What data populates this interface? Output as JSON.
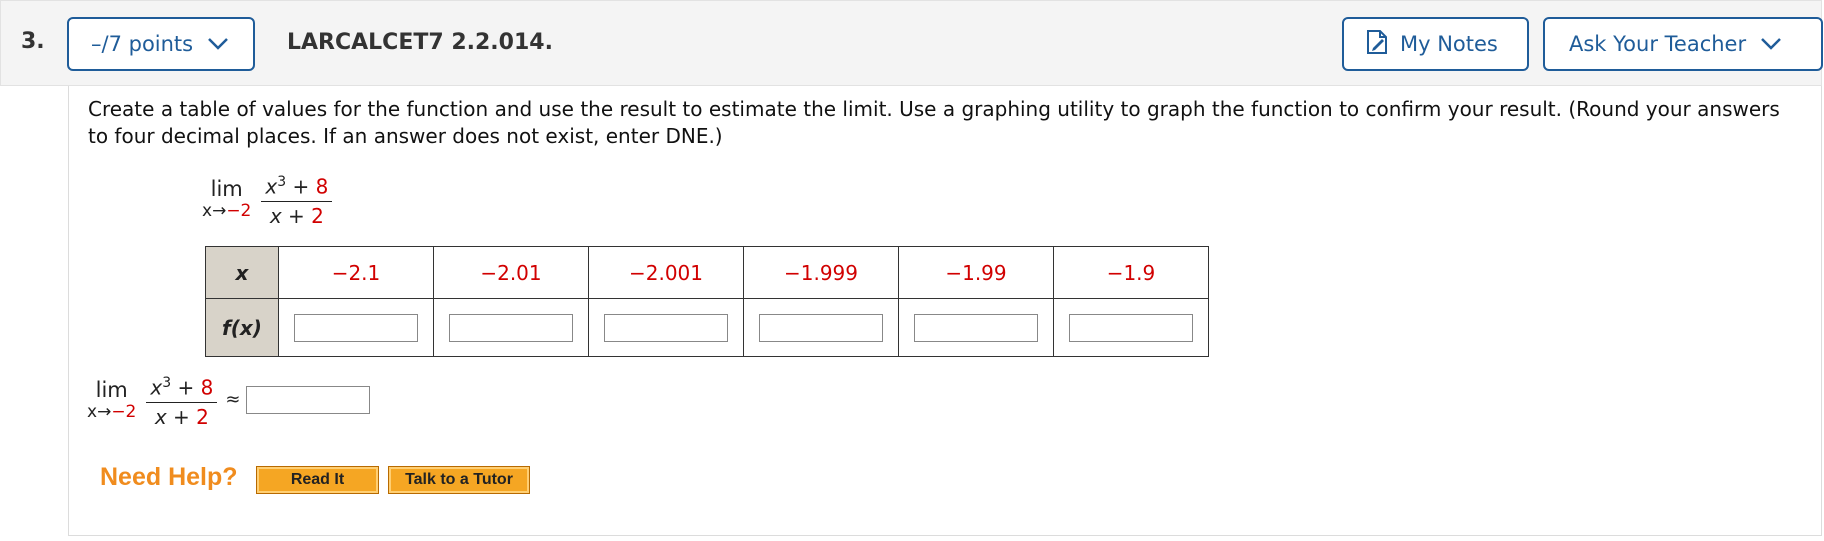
{
  "question": {
    "number": "3.",
    "points_label": "–/7 points",
    "id": "LARCALCET7 2.2.014.",
    "my_notes_label": "My Notes",
    "ask_teacher_label": "Ask Your Teacher"
  },
  "instructions": "Create a table of values for the function and use the result to estimate the limit. Use a graphing utility to graph the function to confirm your result. (Round your answers to four decimal places. If an answer does not exist, enter DNE.)",
  "limit": {
    "word": "lim",
    "var": "x",
    "arrow": "→",
    "approach": "−2",
    "num_var": "x",
    "num_exp": "3",
    "num_plus": " + ",
    "num_const": "8",
    "den_var": "x",
    "den_plus": " + ",
    "den_const": "2",
    "approx_symbol": "≈"
  },
  "table": {
    "x_header": "x",
    "fx_header": "f(x)",
    "x_values": [
      "−2.1",
      "−2.01",
      "−2.001",
      "−1.999",
      "−1.99",
      "−1.9"
    ],
    "fx_values": [
      "",
      "",
      "",
      "",
      "",
      ""
    ]
  },
  "limit_answer": "",
  "help": {
    "label": "Need Help?",
    "read_it": "Read It",
    "talk_tutor": "Talk to a Tutor"
  }
}
